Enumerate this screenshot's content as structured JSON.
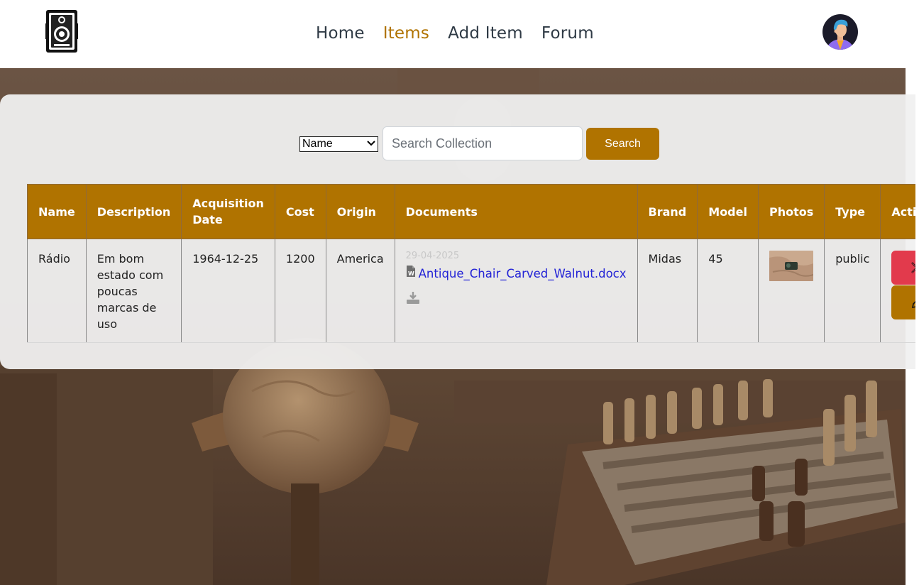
{
  "nav": {
    "links": [
      {
        "label": "Home",
        "active": false
      },
      {
        "label": "Items",
        "active": true
      },
      {
        "label": "Add Item",
        "active": false
      },
      {
        "label": "Forum",
        "active": false
      }
    ],
    "logo_icon": "camera-logo-icon",
    "avatar_icon": "user-avatar"
  },
  "search": {
    "filter_selected": "Name",
    "placeholder": "Search Collection",
    "button_label": "Search"
  },
  "table": {
    "headers": [
      "Name",
      "Description",
      "Acquisition Date",
      "Cost",
      "Origin",
      "Documents",
      "Brand",
      "Model",
      "Photos",
      "Type",
      "Actions"
    ],
    "rows": [
      {
        "name": "Rádio",
        "description": "Em bom estado com poucas marcas de uso",
        "acquisition_date": "1964-12-25",
        "cost": "1200",
        "origin": "America",
        "document_date": "29-04-2025",
        "document_name": "Antique_Chair_Carved_Walnut.docx",
        "brand": "Midas",
        "model": "45",
        "type": "public"
      }
    ]
  },
  "colors": {
    "accent": "#b07300",
    "danger": "#e23a4c",
    "link": "#2323d6"
  }
}
